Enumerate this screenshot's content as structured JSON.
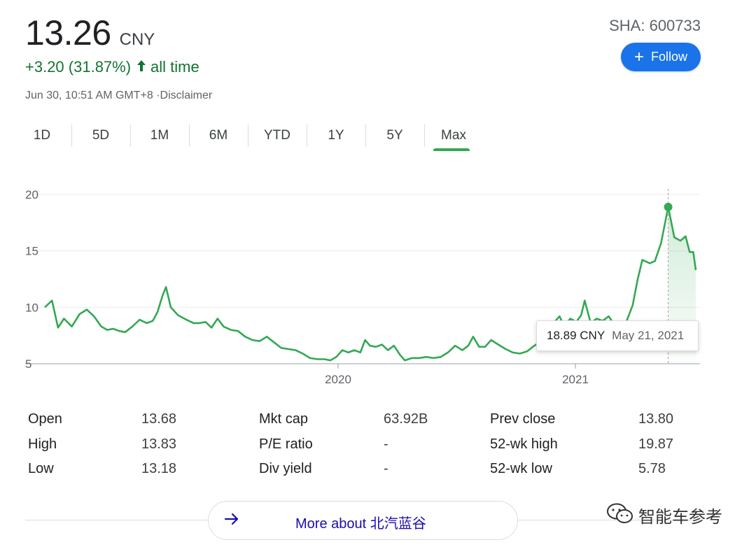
{
  "quote": {
    "price": "13.26",
    "currency": "CNY",
    "change": "+3.20 (31.87%)",
    "change_arrow": "arrow-up-icon",
    "change_period": "all time",
    "timestamp": "Jun 30, 10:51 AM GMT+8 ·Disclaimer",
    "ticker": "SHA: 600733",
    "accent_color": "#137333"
  },
  "follow_button": {
    "label": "Follow",
    "icon": "plus-icon",
    "color": "#1a73e8"
  },
  "ranges": [
    {
      "label": "1D"
    },
    {
      "label": "5D"
    },
    {
      "label": "1M"
    },
    {
      "label": "6M"
    },
    {
      "label": "YTD"
    },
    {
      "label": "1Y"
    },
    {
      "label": "5Y"
    },
    {
      "label": "Max",
      "active": true
    }
  ],
  "chart_data": {
    "type": "line",
    "y_ticks": [
      "20",
      "15",
      "10",
      "5"
    ],
    "x_ticks": [
      "2020",
      "2021"
    ],
    "ylim": [
      5,
      20
    ],
    "line_color": "#34a853",
    "grid": true,
    "series": [
      {
        "values": [
          [
            0.0,
            10.0
          ],
          [
            0.012,
            10.6
          ],
          [
            0.022,
            8.2
          ],
          [
            0.032,
            9.0
          ],
          [
            0.045,
            8.3
          ],
          [
            0.058,
            9.4
          ],
          [
            0.07,
            9.8
          ],
          [
            0.082,
            9.2
          ],
          [
            0.094,
            8.3
          ],
          [
            0.104,
            8.0
          ],
          [
            0.114,
            8.1
          ],
          [
            0.124,
            7.9
          ],
          [
            0.134,
            7.8
          ],
          [
            0.146,
            8.3
          ],
          [
            0.158,
            8.9
          ],
          [
            0.17,
            8.6
          ],
          [
            0.18,
            8.8
          ],
          [
            0.188,
            9.6
          ],
          [
            0.196,
            11.0
          ],
          [
            0.202,
            11.8
          ],
          [
            0.21,
            10.0
          ],
          [
            0.222,
            9.3
          ],
          [
            0.236,
            8.9
          ],
          [
            0.248,
            8.6
          ],
          [
            0.258,
            8.6
          ],
          [
            0.268,
            8.7
          ],
          [
            0.278,
            8.2
          ],
          [
            0.288,
            9.0
          ],
          [
            0.298,
            8.3
          ],
          [
            0.31,
            8.0
          ],
          [
            0.322,
            7.9
          ],
          [
            0.334,
            7.4
          ],
          [
            0.346,
            7.1
          ],
          [
            0.358,
            7.0
          ],
          [
            0.37,
            7.4
          ],
          [
            0.382,
            6.9
          ],
          [
            0.394,
            6.4
          ],
          [
            0.406,
            6.3
          ],
          [
            0.418,
            6.2
          ],
          [
            0.43,
            5.9
          ],
          [
            0.442,
            5.5
          ],
          [
            0.454,
            5.4
          ],
          [
            0.466,
            5.4
          ],
          [
            0.476,
            5.3
          ],
          [
            0.486,
            5.6
          ],
          [
            0.496,
            6.2
          ],
          [
            0.506,
            6.0
          ],
          [
            0.516,
            6.2
          ],
          [
            0.526,
            6.0
          ],
          [
            0.534,
            7.1
          ],
          [
            0.542,
            6.6
          ],
          [
            0.552,
            6.5
          ],
          [
            0.562,
            6.7
          ],
          [
            0.572,
            6.2
          ],
          [
            0.582,
            6.6
          ],
          [
            0.592,
            5.8
          ],
          [
            0.6,
            5.3
          ],
          [
            0.612,
            5.5
          ],
          [
            0.624,
            5.5
          ],
          [
            0.636,
            5.6
          ],
          [
            0.648,
            5.5
          ],
          [
            0.66,
            5.6
          ],
          [
            0.672,
            6.0
          ],
          [
            0.684,
            6.6
          ],
          [
            0.696,
            6.2
          ],
          [
            0.706,
            6.6
          ],
          [
            0.714,
            7.4
          ],
          [
            0.724,
            6.5
          ],
          [
            0.734,
            6.5
          ],
          [
            0.744,
            7.1
          ],
          [
            0.756,
            6.7
          ],
          [
            0.768,
            6.3
          ],
          [
            0.78,
            6.0
          ],
          [
            0.792,
            5.9
          ],
          [
            0.804,
            6.1
          ],
          [
            0.816,
            6.6
          ],
          [
            0.828,
            7.0
          ],
          [
            0.838,
            7.8
          ],
          [
            0.848,
            8.6
          ],
          [
            0.858,
            9.2
          ],
          [
            0.866,
            8.3
          ],
          [
            0.876,
            9.0
          ],
          [
            0.886,
            8.7
          ],
          [
            0.894,
            9.3
          ],
          [
            0.9,
            10.6
          ],
          [
            0.91,
            8.6
          ],
          [
            0.92,
            9.0
          ],
          [
            0.93,
            8.8
          ],
          [
            0.94,
            9.2
          ],
          [
            0.95,
            8.4
          ],
          [
            0.96,
            8.6
          ],
          [
            0.97,
            8.8
          ],
          [
            0.98,
            10.2
          ],
          [
            0.988,
            12.4
          ],
          [
            0.996,
            14.2
          ]
        ]
      }
    ],
    "zoom_segment": [
      [
        0.0,
        14.2
      ],
      [
        0.1,
        13.9
      ],
      [
        0.2,
        14.1
      ],
      [
        0.32,
        15.7
      ],
      [
        0.46,
        18.89
      ],
      [
        0.58,
        16.2
      ],
      [
        0.7,
        15.9
      ],
      [
        0.8,
        16.3
      ],
      [
        0.88,
        14.9
      ],
      [
        0.95,
        14.9
      ],
      [
        1.0,
        13.3
      ]
    ],
    "tooltip": {
      "value": "18.89 CNY",
      "date": "May 21, 2021"
    }
  },
  "stats": {
    "open": {
      "label": "Open",
      "value": "13.68"
    },
    "high": {
      "label": "High",
      "value": "13.83"
    },
    "low": {
      "label": "Low",
      "value": "13.18"
    },
    "mkt_cap": {
      "label": "Mkt cap",
      "value": "63.92B"
    },
    "pe_ratio": {
      "label": "P/E ratio",
      "value": "-"
    },
    "div_yield": {
      "label": "Div yield",
      "value": "-"
    },
    "prev_close": {
      "label": "Prev close",
      "value": "13.80"
    },
    "wk52_high": {
      "label": "52-wk high",
      "value": "19.87"
    },
    "wk52_low": {
      "label": "52-wk low",
      "value": "5.78"
    }
  },
  "more": {
    "label": "More about 北汽蓝谷",
    "icon": "arrow-right-icon"
  },
  "watermark": {
    "text": "智能车参考",
    "icon": "wechat-icon"
  }
}
